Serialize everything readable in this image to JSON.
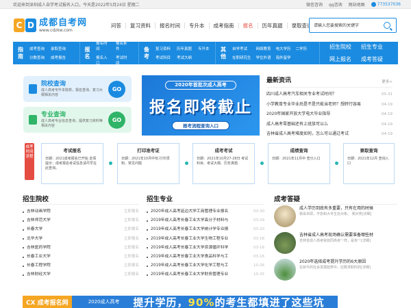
{
  "topbar": {
    "welcome": "欢迎来到深圳成人自学考试报名入口，今天是2022年5月24日 星期二",
    "links": [
      "微信咨询",
      "qq咨询",
      "网站地图"
    ],
    "phone": "773537036"
  },
  "logo": {
    "c": "C",
    "d": "D",
    "name": "成都自考网",
    "url": "www.cdzkw.com"
  },
  "nav": [
    "问答",
    "复习资料",
    "报名时间",
    "专升本",
    "成考指南",
    "报名",
    "历年真题",
    "录取查询"
  ],
  "search": {
    "placeholder": "请输入您要搜索的关键字"
  },
  "sections": [
    {
      "title": "指南",
      "links": [
        "成考查询",
        "录取查询",
        "",
        "分数查询",
        "成考报告",
        ""
      ]
    },
    {
      "title": "报名",
      "links": [
        "报名时间",
        "报名条件",
        "",
        "报名入口",
        "考试时间",
        ""
      ]
    },
    {
      "title": "备考",
      "links": [
        "复习资料",
        "历年真题",
        "专升本",
        "考试科目",
        "考试大纲",
        ""
      ]
    },
    {
      "title": "其他",
      "links": [
        "自学考试",
        "网络教育",
        "电大学历",
        "二学历",
        "在职研究生",
        "学位外语",
        "海外留学",
        ""
      ]
    }
  ],
  "bluebar_last": [
    "招生院校",
    "招生专业",
    "网上报名",
    "成考答疑"
  ],
  "promos": [
    {
      "title": "院校查询",
      "desc": "成人高考专升本院校，报名查询、复习大纲相关内容",
      "go": "GO"
    },
    {
      "title": "专业查询",
      "desc": "成人高考专业信息查询，提供复习资料等相关内容",
      "go": "GO"
    }
  ],
  "banner": {
    "top": "2020年首批次成人高考",
    "main": "报名即将截止",
    "btn": "报考流程查询入口"
  },
  "news": {
    "title": "最新资讯",
    "more": "更多>",
    "items": [
      {
        "text": "四川成人高考汽车相关专业考试时间？",
        "date": "05-31"
      },
      {
        "text": "小学教育专业毕业后是不是只能当老师？想转行容易",
        "date": "04-19"
      },
      {
        "text": "2020年国家开放大学电大毕业指导",
        "date": "04-19"
      },
      {
        "text": "成人高考零基础还有上班族可以么",
        "date": "04-19"
      },
      {
        "text": "吉林省成人高考难度如何，怎么可以通过考试",
        "date": "04-19"
      }
    ]
  },
  "steps_label": "成考时间流程",
  "steps": [
    {
      "title": "考试报名",
      "desc": "日期：2021成考报名已开始 友情提示：成考报名考试信息请尽早在此查询。"
    },
    {
      "title": "打印准考证",
      "desc": "日期：2021年10月中旬 打印须知、常见问题"
    },
    {
      "title": "成考考试",
      "desc": "日期：2021年10月27-28日 考试科目、考试大纲、历年真题"
    },
    {
      "title": "成绩查询",
      "desc": "日期：2021年11月中 查分入口"
    },
    {
      "title": "录取查询",
      "desc": "日期：2021年12月 查询入口"
    }
  ],
  "colleges": {
    "title": "招生院校",
    "items": [
      {
        "name": "吉林动画学院",
        "time": "立即报名"
      },
      {
        "name": "吉林师范大学",
        "time": "立即报名"
      },
      {
        "name": "长春大学",
        "time": "立即报名"
      },
      {
        "name": "北华大学",
        "time": "立即报名"
      },
      {
        "name": "吉林医药学院",
        "time": "立即报名"
      },
      {
        "name": "长春工业大学",
        "time": "立即报名"
      },
      {
        "name": "长春工程学院",
        "time": "立即报名"
      },
      {
        "name": "吉林财经大学",
        "time": "立即报名"
      }
    ]
  },
  "majors": {
    "title": "招生专业",
    "items": [
      {
        "name": "2020年成人高考延边大学工商管理专业报名",
        "time": "03-30"
      },
      {
        "name": "2019年成人高考长春工业大学高分子材料与",
        "time": "03-29"
      },
      {
        "name": "2019年成人高考长春工业大学统计学专业报",
        "time": "03-20"
      },
      {
        "name": "2019年成人高考长春工业大学生物工程专业",
        "time": "03-18"
      },
      {
        "name": "2019年成人高考长春工业大学资源循环科学",
        "time": "03-16"
      },
      {
        "name": "2019年成人高考长春工业大学食品科学与工",
        "time": "03-16"
      },
      {
        "name": "2019年成人高考长春工业大学化学工程与工",
        "time": "10-26"
      },
      {
        "name": "2019年成人高考长春工业大学财务管理专业",
        "time": "10-25"
      }
    ]
  },
  "answers": {
    "title": "成考答疑",
    "items": [
      {
        "title": "成人学历到底有多重要，只有在用的时候",
        "desc": "我哥本硕，不愿和大专生处对象。 我对男[详细]"
      },
      {
        "title": "吉林省成人高考现场确认需要准备哪些材",
        "desc": "吉林省成人高考就如同高考一样，是有一[详细]"
      },
      {
        "title": "2020年选择成考提升学历的6大原因",
        "desc": "在如今的社会发展趋势中，应聘求职时的[详细]"
      }
    ]
  },
  "bottom_banner": {
    "logo": "CX 成考报名网",
    "mid1": "2020成人高考",
    "mid2": "报名入口",
    "slogan_a": "提升学历，",
    "slogan_b": "90%",
    "slogan_c": "的考生都填进了这些坑"
  }
}
